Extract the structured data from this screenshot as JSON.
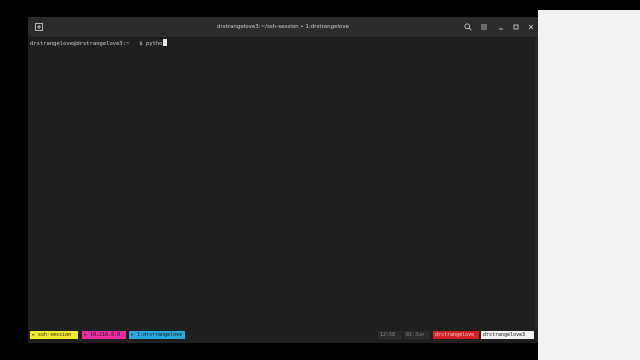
{
  "window": {
    "title": "drstrangelove3:~/ssh-session • 1:drstrangelove",
    "icons": [
      "plus-icon",
      "search-icon",
      "menu-icon",
      "minimize-icon",
      "maximize-icon",
      "close-icon"
    ]
  },
  "terminal": {
    "prompt": "drstrangelove@drstrangelove3",
    "path": "~",
    "symbol": "$",
    "input": "pytho"
  },
  "statusbar": {
    "session": "ssh-session",
    "ip": "10.216.0.0",
    "window": "1:drstrangelove",
    "time": "12:58",
    "date": "01 Jun",
    "user_host": "drstrangelove",
    "host": "drstrangelove3"
  },
  "colors": {
    "terminal_bg": "#1f1f1f",
    "titlebar_bg": "#2b2b2b",
    "session_seg": "#f2ea2e",
    "ip_seg": "#e82ea0",
    "window_seg": "#2aa8e0",
    "user_seg": "#d42020",
    "host_seg": "#f2f2f2"
  }
}
